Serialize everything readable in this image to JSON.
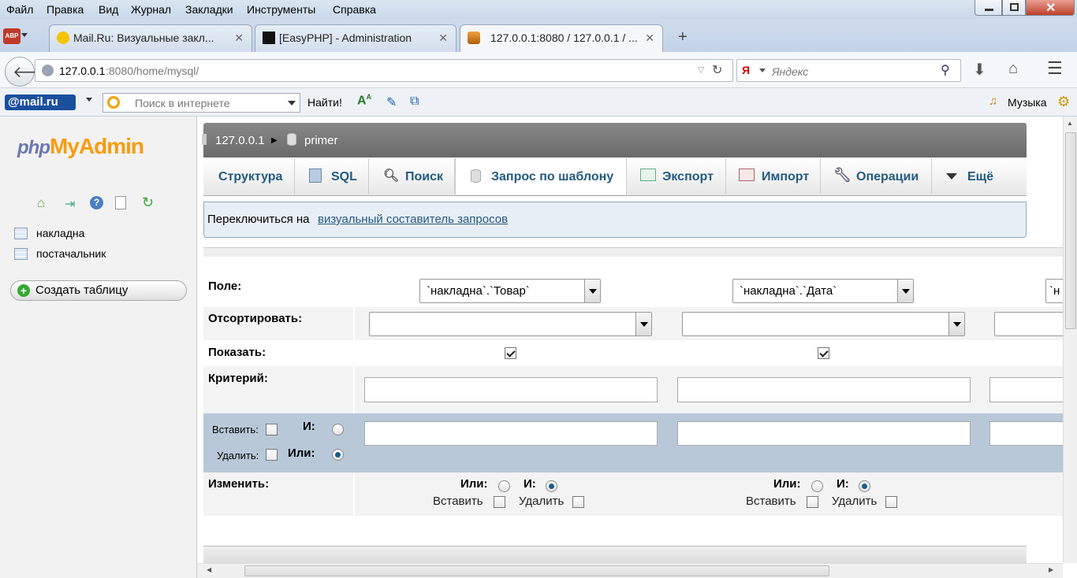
{
  "menu": [
    "Файл",
    "Правка",
    "Вид",
    "Журнал",
    "Закладки",
    "Инструменты",
    "Справка"
  ],
  "tabs": [
    {
      "title": "Mail.Ru: Визуальные закл..."
    },
    {
      "title": "[EasyPHP] - Administration"
    },
    {
      "title": "127.0.0.1:8080 / 127.0.0.1 / ..."
    }
  ],
  "nav": {
    "url_host": "127.0.0.1",
    "url_rest": ":8080/home/mysql/",
    "search_placeholder": "Яндекс"
  },
  "mailbar": {
    "logo": "@mail.ru",
    "search_placeholder": "Поиск в интернете",
    "find_label": "Найти!",
    "music_label": "Музыка"
  },
  "sidebar": {
    "logo_php": "php",
    "logo_admin": "MyAdmin",
    "tables": [
      "накладна",
      "постачальник"
    ],
    "create_table": "Создать таблицу"
  },
  "breadcrumb": {
    "server": "127.0.0.1",
    "db": "primer"
  },
  "pma_tabs": [
    "Структура",
    "SQL",
    "Поиск",
    "Запрос по шаблону",
    "Экспорт",
    "Импорт",
    "Операции",
    "Ещё"
  ],
  "notice": {
    "text": "Переключиться на ",
    "link": "визуальный составитель запросов"
  },
  "grid": {
    "field_label": "Поле:",
    "sort_label": "Отсортировать:",
    "show_label": "Показать:",
    "criteria_label": "Критерий:",
    "insert_label": "Вставить:",
    "delete_label": "Удалить:",
    "and_label": "И:",
    "or_label": "Или:",
    "modify_label": "Изменить:",
    "insert_word": "Вставить",
    "delete_word": "Удалить",
    "columns": [
      {
        "field": "`накладна`.`Товар`",
        "show": true
      },
      {
        "field": "`накладна`.`Дата`",
        "show": true
      }
    ]
  }
}
